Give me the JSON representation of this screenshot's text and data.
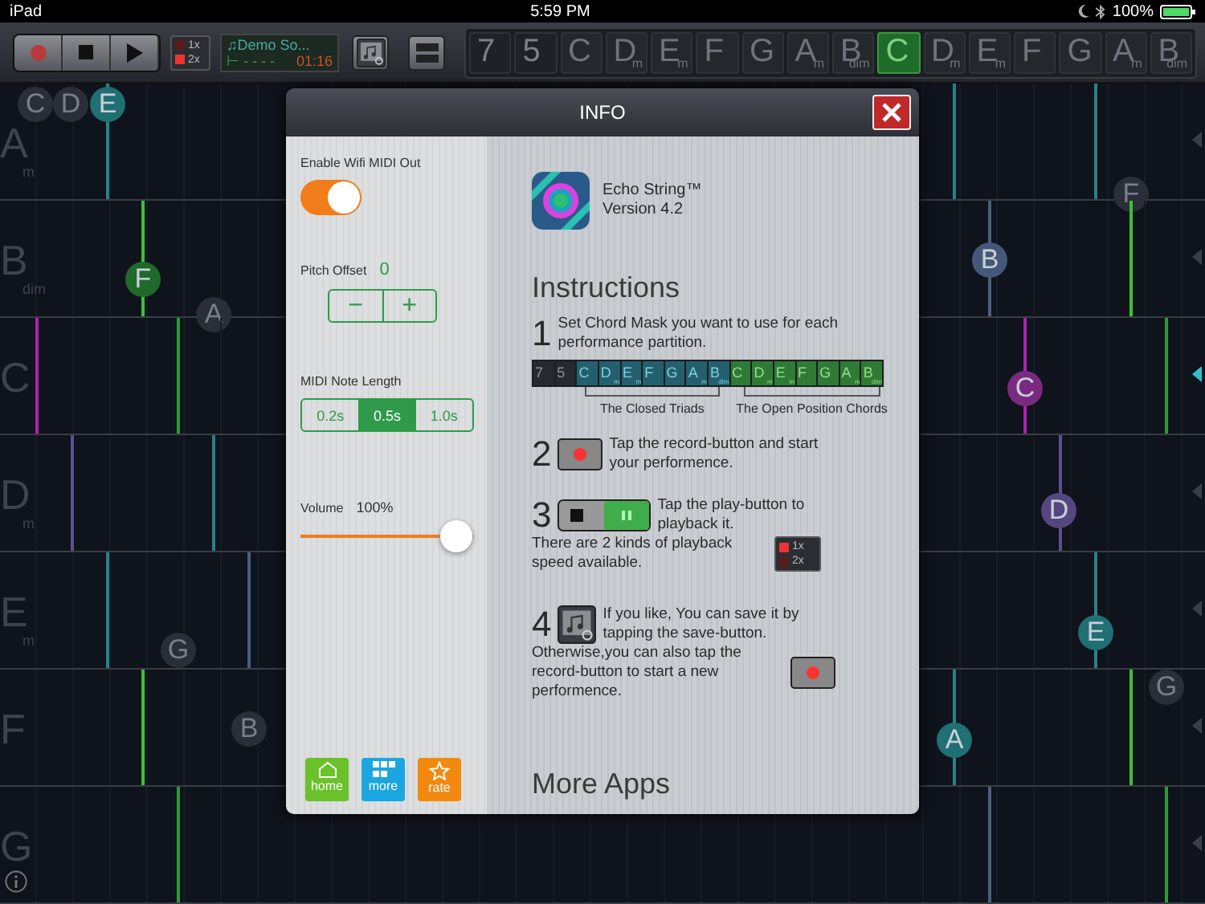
{
  "status_bar": {
    "device": "iPad",
    "time": "5:59 PM",
    "battery": "100%"
  },
  "toolbar": {
    "transport": [
      {
        "kind": "record"
      },
      {
        "kind": "stop"
      },
      {
        "kind": "play"
      }
    ],
    "speeds": [
      {
        "label": "1x",
        "selected": false
      },
      {
        "label": "2x",
        "selected": true
      }
    ],
    "song": {
      "title": "♫Demo So...",
      "progress": "⊢ - - - -",
      "time": "01:16"
    },
    "chord_mask": [
      {
        "root": "7",
        "kind": "mod",
        "selected": false
      },
      {
        "root": "5",
        "kind": "mod",
        "selected": false
      },
      {
        "root": "C",
        "kind": "chord",
        "selected": false
      },
      {
        "root": "D",
        "quality": "m",
        "kind": "chord",
        "selected": false
      },
      {
        "root": "E",
        "quality": "m",
        "kind": "chord",
        "selected": false
      },
      {
        "root": "F",
        "kind": "chord",
        "selected": false
      },
      {
        "root": "G",
        "kind": "chord",
        "selected": false
      },
      {
        "root": "A",
        "quality": "m",
        "kind": "chord",
        "selected": false
      },
      {
        "root": "B",
        "quality": "dim",
        "kind": "chord",
        "selected": false
      },
      {
        "root": "C",
        "kind": "chord",
        "selected": true
      },
      {
        "root": "D",
        "quality": "m",
        "kind": "chord",
        "selected": false
      },
      {
        "root": "E",
        "quality": "m",
        "kind": "chord",
        "selected": false
      },
      {
        "root": "F",
        "kind": "chord",
        "selected": false
      },
      {
        "root": "G",
        "kind": "chord",
        "selected": false
      },
      {
        "root": "A",
        "quality": "m",
        "kind": "chord",
        "selected": false
      },
      {
        "root": "B",
        "quality": "dim",
        "kind": "chord",
        "selected": false
      }
    ]
  },
  "fretboard": {
    "rows": [
      {
        "chord": "A",
        "quality": "m",
        "active": false,
        "strings": [
          {
            "color": "#2a8088"
          },
          {
            "color": "#2a8088"
          },
          {
            "color": "#2a8088"
          }
        ],
        "notes": [
          {
            "label": "C",
            "color": "#2a2e38",
            "faded": true
          },
          {
            "label": "D",
            "color": "#2a2e38",
            "faded": true
          },
          {
            "label": "E",
            "color": "#1f6f73",
            "faded": false
          },
          {
            "label": "F",
            "color": "#2a2e38",
            "faded": true
          }
        ]
      },
      {
        "chord": "B",
        "quality": "dim",
        "active": false,
        "strings": [
          {
            "color": "#3cc03c"
          },
          {
            "color": "#4a5f80"
          },
          {
            "color": "#3cc03c"
          }
        ],
        "notes": [
          {
            "label": "F",
            "color": "#1f6a2a",
            "faded": false
          },
          {
            "label": "A",
            "color": "#2a2e38",
            "faded": true
          },
          {
            "label": "B",
            "color": "#46587a",
            "faded": false
          }
        ]
      },
      {
        "chord": "C",
        "active": true,
        "strings": [
          {
            "color": "#b020b0"
          },
          {
            "color": "#2e9a3a"
          },
          {
            "color": "#b020b0"
          },
          {
            "color": "#2e9a3a"
          }
        ],
        "notes": [
          {
            "label": "C",
            "color": "#7a2a80",
            "faded": false
          }
        ]
      },
      {
        "chord": "D",
        "quality": "m",
        "active": false,
        "strings": [
          {
            "color": "#5e4f90"
          },
          {
            "color": "#2a8088"
          },
          {
            "color": "#5e4f90"
          }
        ],
        "notes": [
          {
            "label": "D",
            "color": "#54477e",
            "faded": false
          }
        ]
      },
      {
        "chord": "E",
        "quality": "m",
        "active": false,
        "strings": [
          {
            "color": "#2a8088"
          },
          {
            "color": "#4a5f80"
          },
          {
            "color": "#2a8088"
          }
        ],
        "notes": [
          {
            "label": "G",
            "color": "#2a2e38",
            "faded": true
          },
          {
            "label": "E",
            "color": "#1f6f73",
            "faded": false
          }
        ]
      },
      {
        "chord": "F",
        "active": false,
        "strings": [
          {
            "color": "#3cc03c"
          },
          {
            "color": "#2a8088"
          },
          {
            "color": "#3cc03c"
          }
        ],
        "notes": [
          {
            "label": "B",
            "color": "#2a2e38",
            "faded": true
          },
          {
            "label": "A",
            "color": "#1f6f73",
            "faded": false
          },
          {
            "label": "G",
            "color": "#2a2e38",
            "faded": true
          }
        ]
      },
      {
        "chord": "G",
        "active": false,
        "strings": [
          {
            "color": "#2e9a3a"
          },
          {
            "color": "#4a5f80"
          },
          {
            "color": "#2e9a3a"
          }
        ]
      }
    ]
  },
  "dialog": {
    "title": "INFO",
    "settings": {
      "wifi_label": "Enable Wifi MIDI Out",
      "wifi_on": true,
      "pitch_label": "Pitch Offset",
      "pitch_value": "0",
      "pitch_buttons": [
        "−",
        "+"
      ],
      "length_label": "MIDI Note Length",
      "lengths": [
        {
          "label": "0.2s",
          "selected": false
        },
        {
          "label": "0.5s",
          "selected": true
        },
        {
          "label": "1.0s",
          "selected": false
        }
      ],
      "volume_label": "Volume",
      "volume_value": "100%",
      "volume": {
        "level": 0.9
      }
    },
    "footer_buttons": [
      {
        "kind": "home",
        "label": "home"
      },
      {
        "kind": "more",
        "label": "more"
      },
      {
        "kind": "rate",
        "label": "rate"
      }
    ],
    "about": {
      "app_name": "Echo String™",
      "version": "Version 4.2"
    },
    "instructions_title": "Instructions",
    "steps": [
      {
        "number": "1",
        "kind": "mask",
        "text": "Set Chord Mask you want to use for each performance partition."
      },
      {
        "number": "2",
        "kind": "record",
        "text": "Tap the record-button and start your performence."
      },
      {
        "number": "3",
        "kind": "play",
        "text": "Tap the play-button to playback it.",
        "note": "There are 2 kinds of playback speed available.",
        "note_icon": {
          "kind": "speed",
          "labels": [
            "1x",
            "2x"
          ]
        }
      },
      {
        "number": "4",
        "kind": "save",
        "text": "If you like, You can save it by tapping the save-button.",
        "note": "Otherwise,you can also tap the record-button to start a new performence.",
        "note_icon": {
          "kind": "record"
        }
      }
    ],
    "mask_example": {
      "keys": [
        {
          "root": "7",
          "kind": "mod"
        },
        {
          "root": "5",
          "kind": "mod"
        },
        {
          "root": "C",
          "kind": "closed"
        },
        {
          "root": "D",
          "quality": "m",
          "kind": "closed"
        },
        {
          "root": "E",
          "quality": "m",
          "kind": "closed"
        },
        {
          "root": "F",
          "kind": "closed"
        },
        {
          "root": "G",
          "kind": "closed"
        },
        {
          "root": "A",
          "quality": "m",
          "kind": "closed"
        },
        {
          "root": "B",
          "quality": "dim",
          "kind": "closed"
        },
        {
          "root": "C",
          "kind": "open"
        },
        {
          "root": "D",
          "quality": "m",
          "kind": "open"
        },
        {
          "root": "E",
          "quality": "m",
          "kind": "open"
        },
        {
          "root": "F",
          "kind": "open"
        },
        {
          "root": "G",
          "kind": "open"
        },
        {
          "root": "A",
          "quality": "m",
          "kind": "open"
        },
        {
          "root": "B",
          "quality": "dim",
          "kind": "open"
        }
      ],
      "groups": [
        "The Closed Triads",
        "The Open Position Chords"
      ]
    },
    "more_apps": "More Apps"
  }
}
